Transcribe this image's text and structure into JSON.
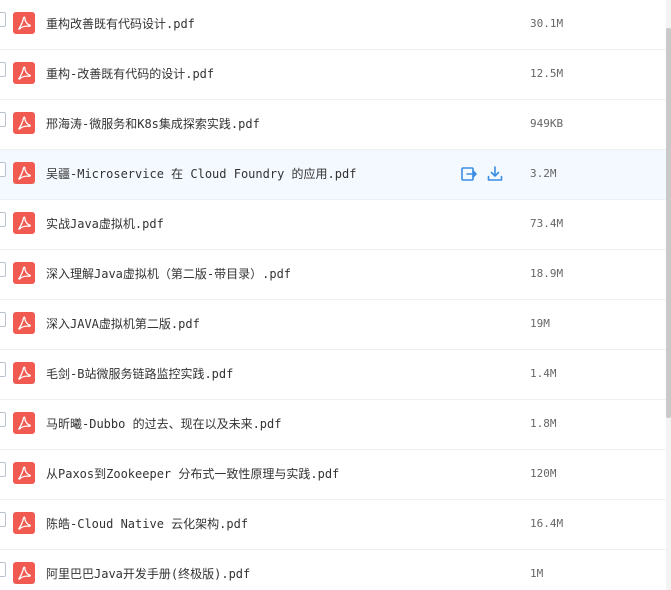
{
  "colors": {
    "pdf_icon": "#f05a50",
    "hover_row": "#f4f9ff",
    "action_icon": "#3b8de3",
    "text": "#333333",
    "size_text": "#666666"
  },
  "icons": {
    "file": "pdf-icon",
    "share": "share-icon",
    "download": "download-icon"
  },
  "files": [
    {
      "name": "重构改善既有代码设计.pdf",
      "size": "30.1M"
    },
    {
      "name": "重构-改善既有代码的设计.pdf",
      "size": "12.5M"
    },
    {
      "name": "邢海涛-微服务和K8s集成探索实践.pdf",
      "size": "949KB"
    },
    {
      "name": "吴疆-Microservice 在 Cloud Foundry 的应用.pdf",
      "size": "3.2M",
      "hovered": true
    },
    {
      "name": "实战Java虚拟机.pdf",
      "size": "73.4M"
    },
    {
      "name": "深入理解Java虚拟机（第二版-带目录）.pdf",
      "size": "18.9M"
    },
    {
      "name": "深入JAVA虚拟机第二版.pdf",
      "size": "19M"
    },
    {
      "name": "毛剑-B站微服务链路监控实践.pdf",
      "size": "1.4M"
    },
    {
      "name": "马昕曦-Dubbo 的过去、现在以及未来.pdf",
      "size": "1.8M"
    },
    {
      "name": "从Paxos到Zookeeper 分布式一致性原理与实践.pdf",
      "size": "120M"
    },
    {
      "name": "陈皓-Cloud Native 云化架构.pdf",
      "size": "16.4M"
    },
    {
      "name": "阿里巴巴Java开发手册(终极版).pdf",
      "size": "1M"
    }
  ]
}
